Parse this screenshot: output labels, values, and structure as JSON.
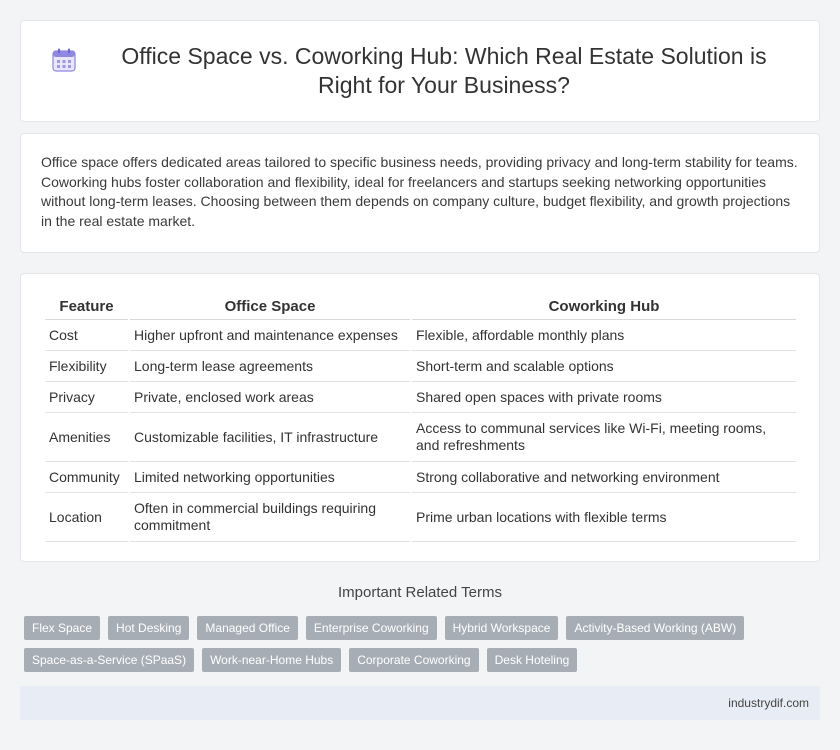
{
  "header": {
    "title": "Office Space vs. Coworking Hub: Which Real Estate Solution is Right for Your Business?",
    "icon": "calendar-icon"
  },
  "intro": {
    "text": "Office space offers dedicated areas tailored to specific business needs, providing privacy and long-term stability for teams. Coworking hubs foster collaboration and flexibility, ideal for freelancers and startups seeking networking opportunities without long-term leases. Choosing between them depends on company culture, budget flexibility, and growth projections in the real estate market."
  },
  "table": {
    "headers": [
      "Feature",
      "Office Space",
      "Coworking Hub"
    ],
    "rows": [
      [
        "Cost",
        "Higher upfront and maintenance expenses",
        "Flexible, affordable monthly plans"
      ],
      [
        "Flexibility",
        "Long-term lease agreements",
        "Short-term and scalable options"
      ],
      [
        "Privacy",
        "Private, enclosed work areas",
        "Shared open spaces with private rooms"
      ],
      [
        "Amenities",
        "Customizable facilities, IT infrastructure",
        "Access to communal services like Wi-Fi, meeting rooms, and refreshments"
      ],
      [
        "Community",
        "Limited networking opportunities",
        "Strong collaborative and networking environment"
      ],
      [
        "Location",
        "Often in commercial buildings requiring commitment",
        "Prime urban locations with flexible terms"
      ]
    ]
  },
  "related": {
    "title": "Important Related Terms",
    "tags": [
      "Flex Space",
      "Hot Desking",
      "Managed Office",
      "Enterprise Coworking",
      "Hybrid Workspace",
      "Activity-Based Working (ABW)",
      "Space-as-a-Service (SPaaS)",
      "Work-near-Home Hubs",
      "Corporate Coworking",
      "Desk Hoteling"
    ]
  },
  "footer": {
    "site": "industrydif.com"
  },
  "colors": {
    "accent_icon": "#7b74d6",
    "tag_bg": "#a7adb5",
    "footer_bg": "#e8ecf4"
  }
}
